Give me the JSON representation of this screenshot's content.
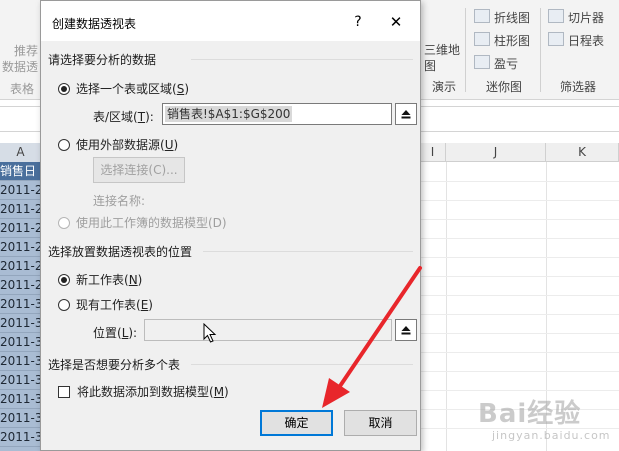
{
  "ribbon": {
    "left_labels": [
      "推荐",
      "数据透",
      "表格"
    ],
    "map_button": "三维地图",
    "map_group": "演示",
    "sparklines": [
      "折线图",
      "柱形图",
      "盈亏"
    ],
    "sparkline_group": "迷你图",
    "filters": [
      "切片器",
      "日程表"
    ],
    "filter_group": "筛选器"
  },
  "sheet": {
    "columns": [
      "A",
      "I",
      "J",
      "K"
    ],
    "col_a_header": "销售日",
    "col_a_rows": [
      "2011-2-",
      "2011-2-",
      "2011-2-",
      "2011-2-",
      "2011-2-",
      "2011-2-",
      "2011-3-",
      "2011-3-",
      "2011-3-",
      "2011-3-",
      "2011-3-",
      "2011-3-",
      "2011-3-",
      "2011-3-",
      "2011-3-"
    ]
  },
  "dialog": {
    "title": "创建数据透视表",
    "help": "?",
    "close": "✕",
    "section1": "请选择要分析的数据",
    "opt_range": "选择一个表或区域(",
    "opt_range_key": "S",
    "opt_range_end": ")",
    "range_label": "表/区域(",
    "range_label_key": "T",
    "range_label_end": "):",
    "range_value": "销售表!$A$1:$G$200",
    "opt_external": "使用外部数据源(",
    "opt_external_key": "U",
    "opt_external_end": ")",
    "choose_conn": "选择连接(C)...",
    "conn_name_label": "连接名称:",
    "opt_model": "使用此工作簿的数据模型(D)",
    "section2": "选择放置数据透视表的位置",
    "opt_new": "新工作表(",
    "opt_new_key": "N",
    "opt_new_end": ")",
    "opt_existing": "现有工作表(",
    "opt_existing_key": "E",
    "opt_existing_end": ")",
    "location_label": "位置(",
    "location_label_key": "L",
    "location_label_end": "):",
    "location_value": "",
    "section3": "选择是否想要分析多个表",
    "add_model": "将此数据添加到数据模型(",
    "add_model_key": "M",
    "add_model_end": ")",
    "ok": "确定",
    "cancel": "取消"
  },
  "watermark": {
    "logo": "Bai经验",
    "sub": "jingyan.baidu.com"
  },
  "colors": {
    "selection_blue": "#a9bcd3",
    "header_blue": "#4a6f9c",
    "focus_blue": "#0078d7",
    "arrow_red": "#e8262b"
  },
  "selected_option": "opt_range",
  "selected_location": "opt_new"
}
